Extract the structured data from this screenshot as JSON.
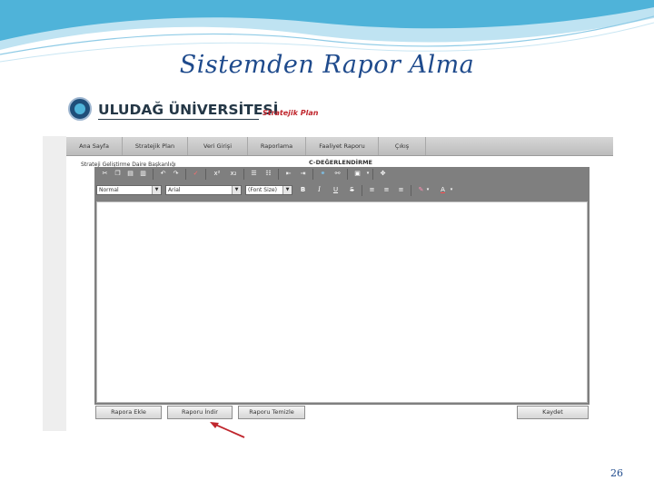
{
  "slide": {
    "title": "Sistemden Rapor Alma",
    "page_number": "26",
    "accent_color": "#1e4a8c",
    "wave_colors": [
      "#4fb3d9",
      "#bfe3f2"
    ]
  },
  "app": {
    "university_name": "ULUDAĞ ÜNİVERSİTESİ",
    "subtitle": "Stratejik Plan",
    "logo_icon": "university-seal-icon",
    "menu": [
      "Ana Sayfa",
      "Stratejik Plan",
      "Veri Girişi",
      "Raporlama",
      "Faaliyet Raporu",
      "Çıkış"
    ],
    "breadcrumb": "Strateji Geliştirme Daire Başkanlığı",
    "section_title": "C-DEĞERLENDİRME"
  },
  "editor": {
    "toolbar_row1_icons": [
      "cut-icon",
      "copy-icon",
      "paste-icon",
      "paste-text-icon",
      "undo-icon",
      "redo-icon",
      "spellcheck-icon",
      "superscript-icon",
      "subscript-icon",
      "ordered-list-icon",
      "unordered-list-icon",
      "outdent-icon",
      "indent-icon",
      "link-icon",
      "unlink-icon",
      "image-icon",
      "table-icon",
      "source-icon"
    ],
    "toolbar_row1_glyphs": {
      "superscript": "x²",
      "subscript": "x₂"
    },
    "format_select": "Normal",
    "font_select": "Arial",
    "size_select": "(Font Size)",
    "bold": "B",
    "italic": "I",
    "underline": "U",
    "strike": "S",
    "font_color_glyph": "A",
    "content": ""
  },
  "buttons": {
    "add_report": "Rapora Ekle",
    "download_report": "Raporu İndir",
    "clear_report": "Raporu Temizle",
    "save": "Kaydet"
  },
  "annotation": {
    "arrow_color": "#c0262d"
  }
}
